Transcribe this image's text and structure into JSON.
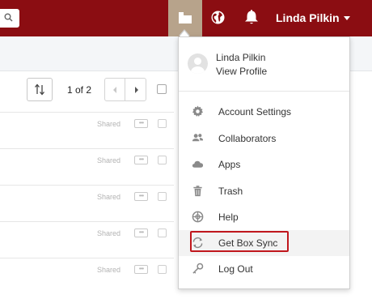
{
  "header": {
    "user_name": "Linda Pilkin",
    "icons": [
      "search-icon",
      "box-sync-icon",
      "globe-icon",
      "bell-icon"
    ]
  },
  "toolbar": {
    "page_indicator": "1 of 2"
  },
  "rows": [
    {
      "status": "Shared"
    },
    {
      "status": "Shared"
    },
    {
      "status": "Shared"
    },
    {
      "status": "Shared"
    },
    {
      "status": "Shared"
    }
  ],
  "user_menu": {
    "name": "Linda Pilkin",
    "view_profile": "View Profile",
    "items": [
      {
        "label": "Account Settings",
        "icon": "gear-icon"
      },
      {
        "label": "Collaborators",
        "icon": "people-icon"
      },
      {
        "label": "Apps",
        "icon": "cloud-icon"
      },
      {
        "label": "Trash",
        "icon": "trash-icon"
      },
      {
        "label": "Help",
        "icon": "lifebuoy-icon"
      },
      {
        "label": "Get Box Sync",
        "icon": "sync-icon"
      },
      {
        "label": "Log Out",
        "icon": "key-icon"
      }
    ]
  },
  "colors": {
    "topbar": "#8b0d12",
    "sync_button_bg": "#b7a38b",
    "highlight_border": "#c0171d"
  }
}
